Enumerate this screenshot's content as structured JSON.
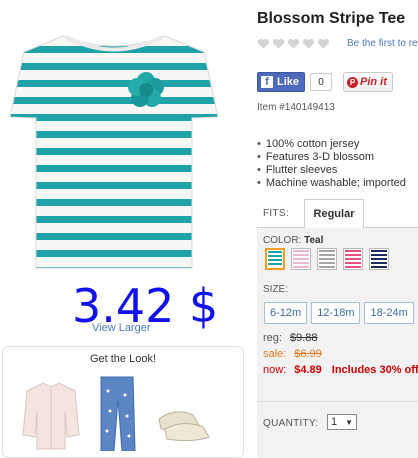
{
  "product": {
    "title": "Blossom Stripe Tee",
    "item_number": "Item #140149413",
    "view_larger": "View Larger",
    "price_overlay": "3.42 $"
  },
  "reviews": {
    "link": "Be the first to review"
  },
  "social": {
    "like_label": "Like",
    "like_count": "0",
    "pin_label": "Pin it"
  },
  "features": [
    "100% cotton jersey",
    "Features 3-D blossom",
    "Flutter sleeves",
    "Machine washable; imported"
  ],
  "fits": {
    "label": "FITS:",
    "tabs": [
      "Regular"
    ]
  },
  "color": {
    "label": "COLOR:",
    "selected": "Teal",
    "swatches": [
      {
        "name": "teal",
        "color": "#1fa3a8"
      },
      {
        "name": "pink-light",
        "color": "#e9b7cf"
      },
      {
        "name": "grey",
        "color": "#a5a5a5"
      },
      {
        "name": "pink-hot",
        "color": "#e8507c"
      },
      {
        "name": "navy",
        "color": "#1c2a5c"
      }
    ]
  },
  "size": {
    "label": "SIZE:",
    "options": [
      "6-12m",
      "12-18m",
      "18-24m"
    ]
  },
  "pricing": {
    "reg_label": "reg:",
    "reg_value": "$9.88",
    "sale_label": "sale:",
    "sale_value": "$6.99",
    "now_label": "now:",
    "now_value": "$4.89",
    "includes": "Includes 30% off"
  },
  "quantity": {
    "label": "QUANTITY:",
    "value": "1"
  },
  "get_the_look": {
    "title": "Get the Look!"
  }
}
